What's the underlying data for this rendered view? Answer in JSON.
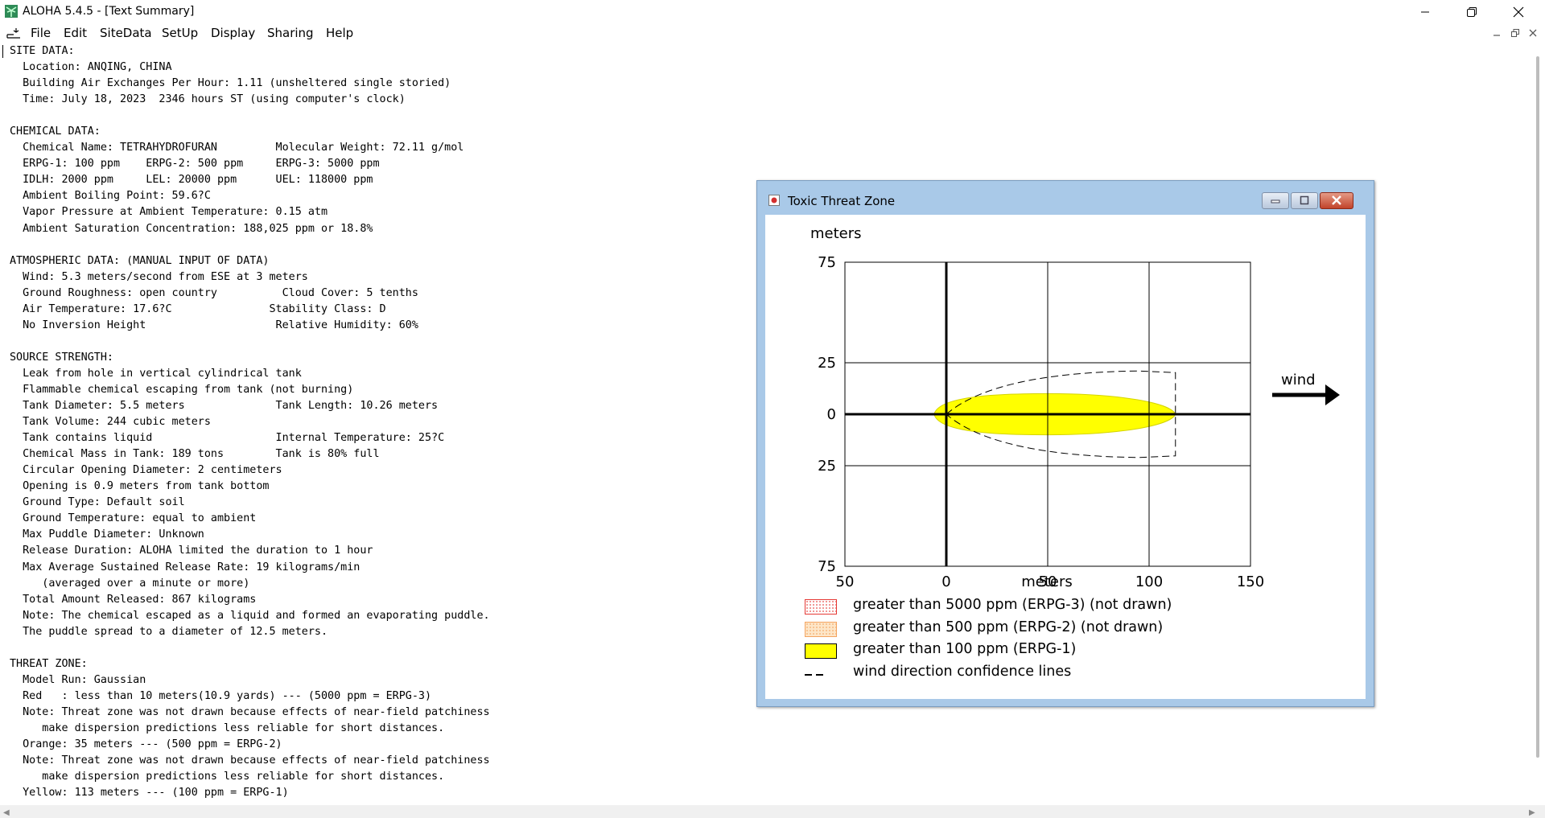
{
  "app": {
    "title": "ALOHA 5.4.5 - [Text Summary]"
  },
  "menu": [
    "File",
    "Edit",
    "SiteData",
    "SetUp",
    "Display",
    "Sharing",
    "Help"
  ],
  "summary": {
    "lines": [
      "SITE DATA:",
      "  Location: ANQING, CHINA",
      "  Building Air Exchanges Per Hour: 1.11 (unsheltered single storied)",
      "  Time: July 18, 2023  2346 hours ST (using computer's clock)",
      "",
      "CHEMICAL DATA:",
      "  Chemical Name: TETRAHYDROFURAN         Molecular Weight: 72.11 g/mol",
      "  ERPG-1: 100 ppm    ERPG-2: 500 ppm     ERPG-3: 5000 ppm",
      "  IDLH: 2000 ppm     LEL: 20000 ppm      UEL: 118000 ppm",
      "  Ambient Boiling Point: 59.6?C",
      "  Vapor Pressure at Ambient Temperature: 0.15 atm",
      "  Ambient Saturation Concentration: 188,025 ppm or 18.8%",
      "",
      "ATMOSPHERIC DATA: (MANUAL INPUT OF DATA)",
      "  Wind: 5.3 meters/second from ESE at 3 meters",
      "  Ground Roughness: open country          Cloud Cover: 5 tenths",
      "  Air Temperature: 17.6?C               Stability Class: D",
      "  No Inversion Height                    Relative Humidity: 60%",
      "",
      "SOURCE STRENGTH:",
      "  Leak from hole in vertical cylindrical tank",
      "  Flammable chemical escaping from tank (not burning)",
      "  Tank Diameter: 5.5 meters              Tank Length: 10.26 meters",
      "  Tank Volume: 244 cubic meters",
      "  Tank contains liquid                   Internal Temperature: 25?C",
      "  Chemical Mass in Tank: 189 tons        Tank is 80% full",
      "  Circular Opening Diameter: 2 centimeters",
      "  Opening is 0.9 meters from tank bottom",
      "  Ground Type: Default soil",
      "  Ground Temperature: equal to ambient",
      "  Max Puddle Diameter: Unknown",
      "  Release Duration: ALOHA limited the duration to 1 hour",
      "  Max Average Sustained Release Rate: 19 kilograms/min",
      "     (averaged over a minute or more)",
      "  Total Amount Released: 867 kilograms",
      "  Note: The chemical escaped as a liquid and formed an evaporating puddle.",
      "  The puddle spread to a diameter of 12.5 meters.",
      "",
      "THREAT ZONE:",
      "  Model Run: Gaussian",
      "  Red   : less than 10 meters(10.9 yards) --- (5000 ppm = ERPG-3)",
      "  Note: Threat zone was not drawn because effects of near-field patchiness",
      "     make dispersion predictions less reliable for short distances.",
      "  Orange: 35 meters --- (500 ppm = ERPG-2)",
      "  Note: Threat zone was not drawn because effects of near-field patchiness",
      "     make dispersion predictions less reliable for short distances.",
      "  Yellow: 113 meters --- (100 ppm = ERPG-1)"
    ]
  },
  "threat_window": {
    "title": "Toxic Threat Zone",
    "wind_label": "wind",
    "legend": [
      {
        "label": "greater than 5000 ppm (ERPG-3) (not drawn)",
        "color": "#e53935",
        "style": "dotted"
      },
      {
        "label": "greater than 500 ppm (ERPG-2) (not drawn)",
        "color": "#f4a460",
        "style": "dotted"
      },
      {
        "label": "greater than 100 ppm (ERPG-1)",
        "color": "#ffff00",
        "style": "solid"
      },
      {
        "label": "wind direction confidence lines",
        "color": "#000000",
        "style": "dashed"
      }
    ]
  },
  "chart_data": {
    "type": "area",
    "xlabel": "meters",
    "ylabel": "meters",
    "xlim": [
      -50,
      150
    ],
    "ylim": [
      -75,
      75
    ],
    "x_ticks": [
      "50",
      "0",
      "50",
      "100",
      "150"
    ],
    "x_tick_values": [
      -50,
      0,
      50,
      100,
      150
    ],
    "y_ticks": [
      "75",
      "25",
      "0",
      "25",
      "75"
    ],
    "y_tick_values": [
      75,
      25,
      0,
      -25,
      -75
    ],
    "grid": true,
    "series": [
      {
        "name": "greater than 100 ppm (ERPG-1)",
        "type": "plume",
        "x_start": -6,
        "x_end": 113,
        "max_halfwidth": 10,
        "x_at_max": 50,
        "color": "#ffff00"
      },
      {
        "name": "wind direction confidence lines",
        "type": "dashed",
        "x_start": 0,
        "x_end": 113,
        "max_halfwidth": 21,
        "color": "#000000"
      }
    ]
  }
}
